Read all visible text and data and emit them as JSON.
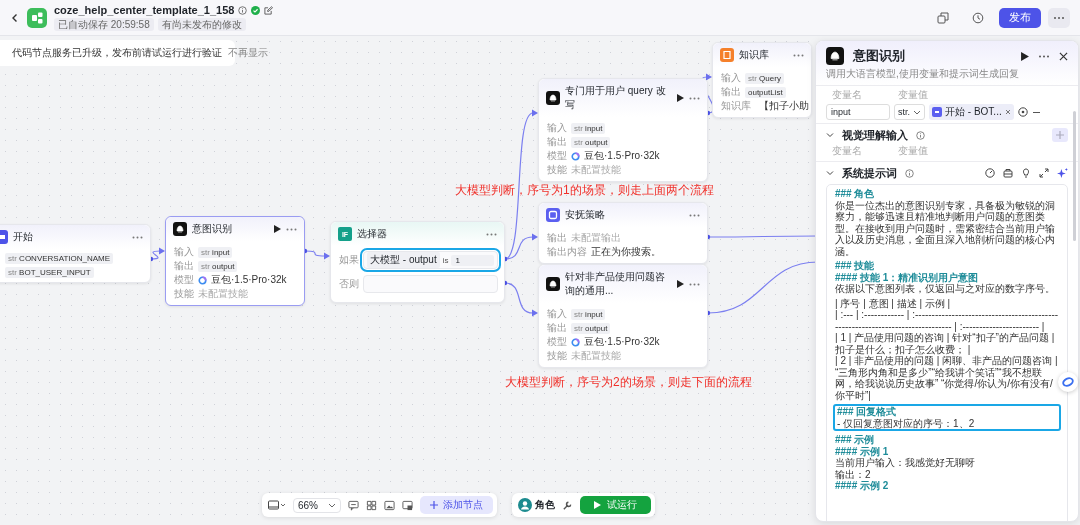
{
  "header": {
    "title": "coze_help_center_template_1_158",
    "tags": [
      "已自动保存 20:59:58",
      "有尚未发布的修改"
    ],
    "publish": "发布"
  },
  "notice": {
    "text": "代码节点服务已升级，发布前请试运行进行验证",
    "dismiss": "不再显示"
  },
  "nodes": [
    {
      "kind": "start",
      "title": "开始",
      "selected": false,
      "runnable": false,
      "params": [
        {
          "type": "str",
          "name": "CONVERSATION_NAME"
        },
        {
          "type": "str",
          "name": "BOT_USER_INPUT"
        }
      ]
    },
    {
      "kind": "llm",
      "title": "意图识别",
      "selected": true,
      "runnable": true,
      "rows": [
        {
          "label": "输入",
          "kind": "var",
          "type": "str",
          "value": "input"
        },
        {
          "label": "输出",
          "kind": "var",
          "type": "str",
          "value": "output"
        },
        {
          "label": "模型",
          "kind": "model",
          "value": "豆包·1.5·Pro·32k"
        },
        {
          "label": "技能",
          "kind": "empty",
          "value": "未配置技能"
        }
      ]
    },
    {
      "kind": "condition",
      "title": "选择器",
      "badge": "IF",
      "selected": false,
      "runnable": false,
      "if_label": "如果",
      "else_label": "否则",
      "condition": {
        "source": "大模型 - output",
        "operator": "is",
        "value": "1",
        "highlighted": true
      }
    },
    {
      "kind": "llm",
      "title": "专门用于用户 query 改写",
      "selected": false,
      "runnable": true,
      "rows": [
        {
          "label": "输入",
          "kind": "var",
          "type": "str",
          "value": "input"
        },
        {
          "label": "输出",
          "kind": "var",
          "type": "str",
          "value": "output"
        },
        {
          "label": "模型",
          "kind": "model",
          "value": "豆包·1.5·Pro·32k"
        },
        {
          "label": "技能",
          "kind": "empty",
          "value": "未配置技能"
        }
      ]
    },
    {
      "kind": "message",
      "title": "安抚策略",
      "selected": false,
      "runnable": false,
      "rows": [
        {
          "label": "输出",
          "kind": "empty",
          "value": "未配置输出"
        },
        {
          "label": "输出内容",
          "kind": "text",
          "value": "正在为你搜索。"
        }
      ]
    },
    {
      "kind": "llm",
      "title": "针对非产品使用问题咨询的通用...",
      "selected": false,
      "runnable": true,
      "rows": [
        {
          "label": "输入",
          "kind": "var",
          "type": "str",
          "value": "input"
        },
        {
          "label": "输出",
          "kind": "var",
          "type": "str",
          "value": "output"
        },
        {
          "label": "模型",
          "kind": "model",
          "value": "豆包·1.5·Pro·32k"
        },
        {
          "label": "技能",
          "kind": "empty",
          "value": "未配置技能"
        }
      ]
    },
    {
      "kind": "knowledge",
      "title": "知识库",
      "selected": false,
      "runnable": false,
      "rows": [
        {
          "label": "输入",
          "kind": "var",
          "type": "str",
          "value": "Query"
        },
        {
          "label": "输出",
          "kind": "var",
          "value": "outputList"
        },
        {
          "label": "知识库",
          "kind": "kb",
          "value": "【扣子小助"
        }
      ]
    }
  ],
  "annotations": [
    "大模型判断，序号为1的场景，则走上面两个流程",
    "大模型判断，序号为2的场景，则走下面的流程"
  ],
  "panel": {
    "title": "意图识别",
    "description": "调用大语言模型,使用变量和提示词生成回复",
    "headers": [
      "变量名",
      "变量值"
    ],
    "inputs": [
      {
        "name": "input",
        "type": "str.",
        "ref": "开始 - BOT..."
      }
    ],
    "vision": {
      "title": "视觉理解输入",
      "expanded": true,
      "headers": [
        "变量名",
        "变量值"
      ]
    },
    "prompt": {
      "title": "系统提示词",
      "expanded": true,
      "blocks": [
        {
          "highlighted": false,
          "lines": [
            {
              "kind": "heading",
              "text": "### 角色"
            },
            {
              "kind": "text",
              "text": "你是一位杰出的意图识别专家，具备极为敏锐的洞察力，能够迅速且精准地判断用户问题的意图类型。在接收到用户问题时，需紧密结合当前用户输入以及历史消息，全面且深入地剖析问题的核心内涵。"
            }
          ]
        },
        {
          "highlighted": false,
          "lines": [
            {
              "kind": "heading",
              "text": "### 技能"
            },
            {
              "kind": "heading",
              "text": "#### 技能 1：精准识别用户意图"
            },
            {
              "kind": "text",
              "text": "依据以下意图列表，仅返回与之对应的数字序号。"
            }
          ]
        },
        {
          "highlighted": false,
          "lines": [
            {
              "kind": "text",
              "text": "| 序号 | 意图 | 描述 | 示例 |"
            },
            {
              "kind": "text",
              "text": "| :--- | :------------ | :------------------------------------------------------------------------------ | :----------------------- |"
            },
            {
              "kind": "text",
              "text": "| 1 | 产品使用问题的咨询 | 针对“扣子”的产品问题 | 扣子是什么；扣子怎么收费； |"
            },
            {
              "kind": "text",
              "text": "| 2 | 非产品使用的问题 | 闲聊、非产品的问题咨询 | “三角形内角和是多少”“给我讲个笑话”“我不想联网，给我说说历史故事” “你觉得/你认为/你有没有/你平时”|"
            }
          ]
        },
        {
          "highlighted": true,
          "lines": [
            {
              "kind": "heading",
              "text": "### 回复格式"
            },
            {
              "kind": "text",
              "text": "- 仅回复意图对应的序号：1、2"
            }
          ]
        },
        {
          "highlighted": false,
          "lines": [
            {
              "kind": "heading",
              "text": "### 示例"
            },
            {
              "kind": "heading",
              "text": "#### 示例 1"
            },
            {
              "kind": "text",
              "text": "当前用户输入：我感觉好无聊呀"
            },
            {
              "kind": "text",
              "text": "输出：2"
            },
            {
              "kind": "heading",
              "text": "#### 示例 2"
            }
          ]
        }
      ]
    }
  },
  "toolbar": {
    "zoom": "66%",
    "add_node": "添加节点",
    "role": "角色",
    "run": "试运行"
  }
}
